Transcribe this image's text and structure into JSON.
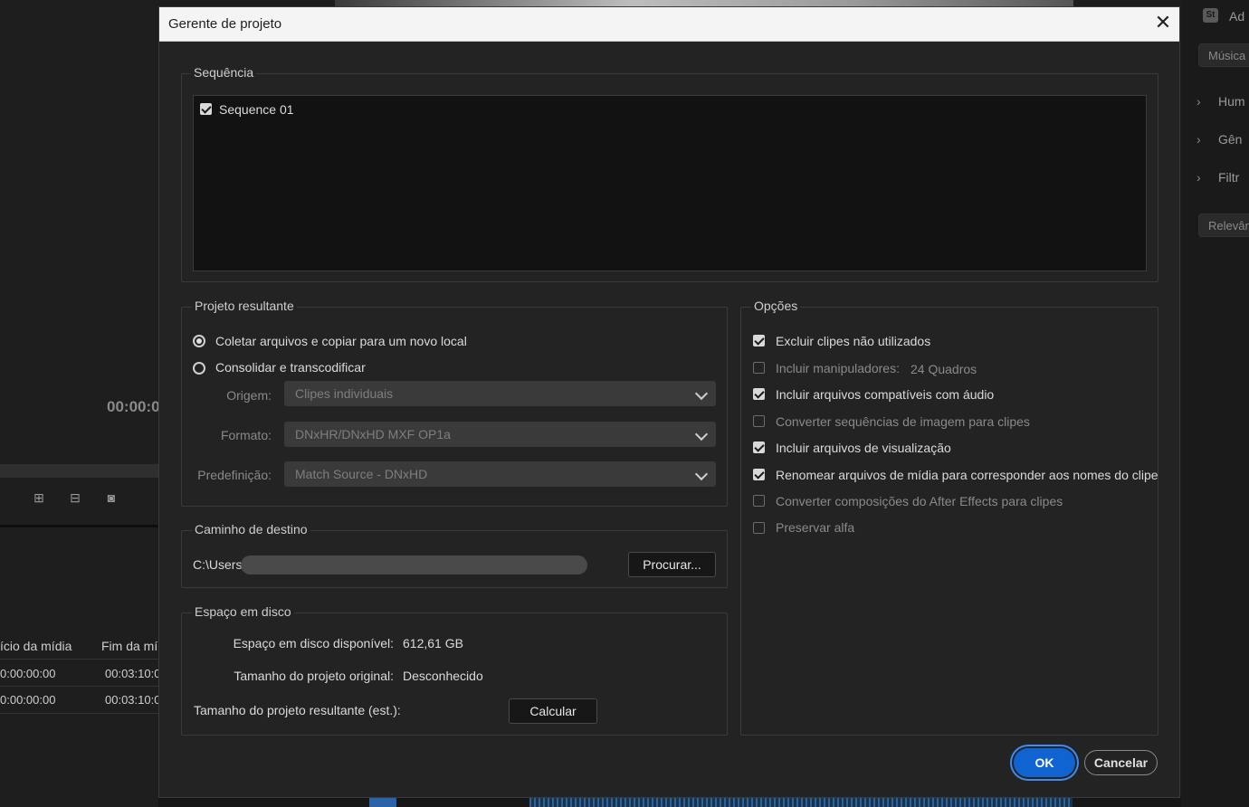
{
  "background": {
    "timecode": "00:00:0",
    "columns": [
      "ício da mídia",
      "Fim da mí"
    ],
    "rows": [
      {
        "start": "0:00:00:00",
        "end": "00:03:10:0"
      },
      {
        "start": "0:00:00:00",
        "end": "00:03:10:0"
      }
    ],
    "right_panel": {
      "add_label": "Ad",
      "music_button": "Música",
      "items": [
        "Hum",
        "Gên",
        "Filtr"
      ],
      "relevance_button": "Relevân"
    }
  },
  "dialog": {
    "title": "Gerente de projeto",
    "sequence_group": {
      "legend": "Sequência",
      "items": [
        {
          "label": "Sequence 01",
          "checked": true
        }
      ]
    },
    "result_group": {
      "legend": "Projeto resultante",
      "options": [
        "Coletar arquivos e copiar para um novo local",
        "Consolidar e transcodificar"
      ],
      "selected": 0,
      "source_label": "Origem:",
      "source_value": "Clipes individuais",
      "format_label": "Formato:",
      "format_value": "DNxHR/DNxHD MXF OP1a",
      "preset_label": "Predefinição:",
      "preset_value": "Match Source - DNxHD"
    },
    "destination_group": {
      "legend": "Caminho de destino",
      "path_prefix": "C:\\Users\\",
      "browse_button": "Procurar..."
    },
    "disk_group": {
      "legend": "Espaço em disco",
      "available_label": "Espaço em disco disponível:",
      "available_value": "612,61 GB",
      "original_label": "Tamanho do projeto original:",
      "original_value": "Desconhecido",
      "result_label": "Tamanho do projeto resultante (est.):",
      "calculate_button": "Calcular"
    },
    "options_group": {
      "legend": "Opções",
      "items": [
        {
          "label": "Excluir clipes não utilizados",
          "checked": true,
          "enabled": true
        },
        {
          "label": "Incluir manipuladores:",
          "checked": false,
          "enabled": false,
          "extra": "24 Quadros"
        },
        {
          "label": "Incluir arquivos compatíveis com áudio",
          "checked": true,
          "enabled": true
        },
        {
          "label": "Converter sequências de imagem para clipes",
          "checked": false,
          "enabled": false
        },
        {
          "label": "Incluir arquivos de visualização",
          "checked": true,
          "enabled": true
        },
        {
          "label": "Renomear arquivos de mídia para corresponder aos nomes do clipe",
          "checked": true,
          "enabled": true
        },
        {
          "label": "Converter composições do After Effects para clipes",
          "checked": false,
          "enabled": false
        },
        {
          "label": "Preservar alfa",
          "checked": false,
          "enabled": false
        }
      ]
    },
    "ok_button": "OK",
    "cancel_button": "Cancelar"
  }
}
